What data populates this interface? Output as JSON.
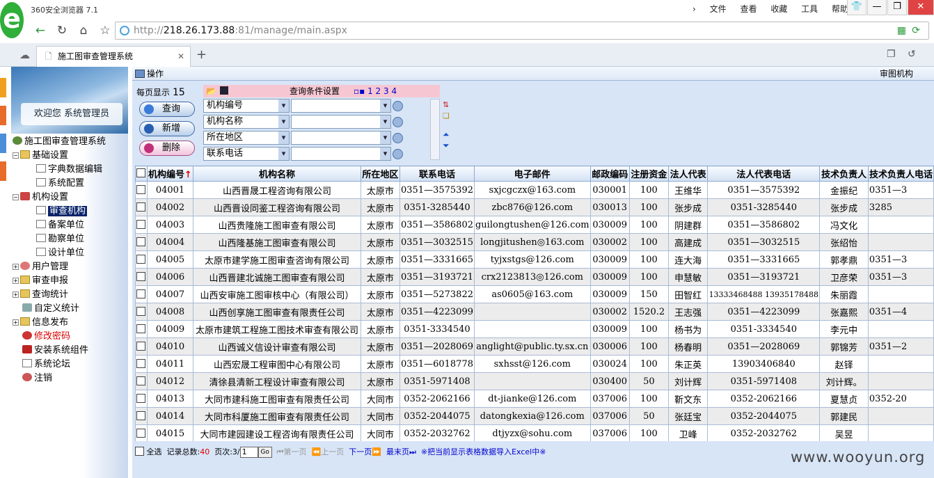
{
  "browser": {
    "title": "360安全浏览器 7.1",
    "menus": [
      "文件",
      "查看",
      "收藏",
      "工具",
      "帮助"
    ],
    "url_prefix": "http://",
    "url_host": "218.26.173.88",
    "url_rest": ":81/manage/main.aspx",
    "tab_title": "施工图审查管理系统"
  },
  "sidebar": {
    "welcome": "欢迎您 系统管理员",
    "items": [
      {
        "label": "施工图审查管理系统"
      },
      {
        "label": "基础设置"
      },
      {
        "label": "字典数据编辑"
      },
      {
        "label": "系统配置"
      },
      {
        "label": "机构设置"
      },
      {
        "label": "审查机构"
      },
      {
        "label": "备案单位"
      },
      {
        "label": "勘察单位"
      },
      {
        "label": "设计单位"
      },
      {
        "label": "用户管理"
      },
      {
        "label": "审查申报"
      },
      {
        "label": "查询统计"
      },
      {
        "label": "自定义统计"
      },
      {
        "label": "信息发布"
      },
      {
        "label": "修改密码"
      },
      {
        "label": "安装系统组件"
      },
      {
        "label": "系统论坛"
      },
      {
        "label": "注销"
      }
    ]
  },
  "toolbar": {
    "op_label": "操作",
    "right_label": "审图机构"
  },
  "query": {
    "per_page_label": "每页显示",
    "per_page_value": "15",
    "btn_search": "查询",
    "btn_add": "新增",
    "btn_delete": "删除",
    "conditions_title": "查询条件设置",
    "condition_pages": "1 2 3 4",
    "fields": [
      "机构编号",
      "机构名称",
      "所在地区",
      "联系电话"
    ]
  },
  "table": {
    "headers": [
      "机构编号",
      "机构名称",
      "所在地区",
      "联系电话",
      "电子邮件",
      "邮政编码",
      "注册资金",
      "法人代表",
      "法人代表电话",
      "技术负责人",
      "技术负责人电话"
    ],
    "rows": [
      [
        "04001",
        "山西晋晟工程咨询有限公司",
        "太原市",
        "0351—3575392",
        "sxjcgczx@163.com",
        "030001",
        "100",
        "王维华",
        "0351—3575392",
        "金振纪",
        "0351—3"
      ],
      [
        "04002",
        "山西晋设同鉴工程咨询有限公司",
        "太原市",
        "0351-3285440",
        "zbc876@126.com",
        "030013",
        "100",
        "张步成",
        "0351-3285440",
        "张步成",
        "3285"
      ],
      [
        "04003",
        "山西贵隆施工图审查有限公司",
        "太原市",
        "0351—3586802",
        "guilongtushen@126.com",
        "030009",
        "100",
        "阴建群",
        "0351—3586802",
        "冯文化",
        ""
      ],
      [
        "04004",
        "山西隆基施工图审查有限公司",
        "太原市",
        "0351—3032515",
        "longjitushen◎163.com",
        "030002",
        "100",
        "高建成",
        "0351—3032515",
        "张绍怡",
        ""
      ],
      [
        "04005",
        "太原市建学施工图审查咨询有限公司",
        "太原市",
        "0351—3331665",
        "tyjxstgs@126.com",
        "030009",
        "100",
        "连大海",
        "0351—3331665",
        "郭孝鼎",
        "0351—3"
      ],
      [
        "04006",
        "山西晋建北诚施工图审查有限公司",
        "太原市",
        "0351—3193721",
        "crx2123813◎126.com",
        "030009",
        "100",
        "申慧敏",
        "0351—3193721",
        "卫彦荣",
        "0351—3"
      ],
      [
        "04007",
        "山西安审施工图审核中心（有限公司）",
        "太原市",
        "0351—5273822",
        "as0605@163.com",
        "030009",
        "150",
        "田智红",
        "13333468488 13935178488",
        "朱丽霞",
        ""
      ],
      [
        "04008",
        "山西创享施工图审查有限责任公司",
        "太原市",
        "0351—4223099",
        "",
        "030002",
        "1520.2",
        "王志强",
        "0351—4223099",
        "张嘉熙",
        "0351—4"
      ],
      [
        "04009",
        "太原市建筑工程施工图技术审查有限公司",
        "太原市",
        "0351-3334540",
        "",
        "030009",
        "100",
        "杨书为",
        "0351-3334540",
        "李元中",
        ""
      ],
      [
        "04010",
        "山西诚义信设计审查有限公司",
        "太原市",
        "0351—2028069",
        "anglight@public.ty.sx.cn",
        "030006",
        "100",
        "杨春明",
        "0351—2028069",
        "郭锦芳",
        "0351—2"
      ],
      [
        "04011",
        "山西宏晟工程审图中心有限公司",
        "太原市",
        "0351—6018778",
        "sxhsst@126.com",
        "030024",
        "100",
        "朱正英",
        "13903406840",
        "赵铎",
        ""
      ],
      [
        "04012",
        "清徐县清新工程设计审查有限公司",
        "太原市",
        "0351-5971408",
        "",
        "030400",
        "50",
        "刘计辉",
        "0351-5971408",
        "刘计辉。",
        ""
      ],
      [
        "04013",
        "大同市建科施工图审查有限责任公司",
        "大同市",
        "0352-2062166",
        "dt-jianke@126.com",
        "037006",
        "100",
        "靳文东",
        "0352-2062166",
        "夏慧贞",
        "0352-20"
      ],
      [
        "04014",
        "大同市科厦施工图审查有限责任公司",
        "大同市",
        "0352-2044075",
        "datongkexia@126.com",
        "037006",
        "50",
        "张廷宝",
        "0352-2044075",
        "郭建民",
        ""
      ],
      [
        "04015",
        "大同市建园建设工程咨询有限责任公司",
        "大同市",
        "0352-2032762",
        "dtjyzx@sohu.com",
        "037006",
        "100",
        "卫峰",
        "0352-2032762",
        "吴昱",
        ""
      ]
    ]
  },
  "footer": {
    "select_all": "全选",
    "total_label": "记录总数:",
    "total_count": "40",
    "page_label": "页次:3/",
    "page_input": "1",
    "go": "Go",
    "first": "第一页",
    "prev": "上一页",
    "next": "下一页",
    "last": "最末页",
    "export": "※把当前显示表格数据导入Excel中※"
  },
  "watermark": "www.wooyun.org"
}
